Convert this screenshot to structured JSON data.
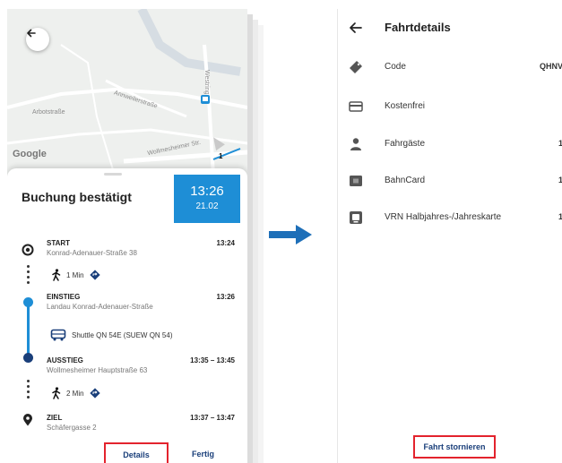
{
  "left_screen": {
    "map": {
      "labels": [
        "Arbotstraße",
        "Annweilerstraße",
        "Westring",
        "Wollmesheimer Str."
      ],
      "logo": "Google",
      "badge": "1"
    },
    "sheet": {
      "title": "Buchung bestätigt",
      "time_card": {
        "time": "13:26",
        "date": "21.02",
        "color": "#1e8ed6"
      },
      "stops": [
        {
          "name": "START",
          "address": "Konrad-Adenauer-Straße 38",
          "time": "13:24",
          "icon": "origin-target-icon"
        },
        {
          "name": "EINSTIEG",
          "address": "Landau Konrad-Adenauer-Straße",
          "time": "13:26",
          "icon": "boarding-dot-icon"
        },
        {
          "name": "AUSSTIEG",
          "address": "Wollmesheimer Hauptstraße 63",
          "time": "13:35 – 13:45",
          "icon": "alighting-dot-icon"
        },
        {
          "name": "ZIEL",
          "address": "Schäfergasse 2",
          "time": "13:37 – 13:47",
          "icon": "destination-pin-icon"
        }
      ],
      "segments": [
        {
          "text": "1 Min",
          "icon": "walk-icon"
        },
        {
          "text": "Shuttle QN 54E (SUEW QN 54)",
          "icon": "bus-icon"
        },
        {
          "text": "2 Min",
          "icon": "walk-icon"
        }
      ],
      "buttons": {
        "details": "Details",
        "done": "Fertig"
      }
    }
  },
  "right_screen": {
    "title": "Fahrtdetails",
    "rows": [
      {
        "label": "Code",
        "value": "QHNV",
        "icon": "ticket-icon"
      },
      {
        "label": "Kostenfrei",
        "value": "",
        "icon": "credit-card-icon"
      },
      {
        "label": "Fahrgäste",
        "value": "1",
        "icon": "person-icon"
      },
      {
        "label": "BahnCard",
        "value": "1",
        "icon": "bahncard-icon"
      },
      {
        "label": "VRN Halbjahres-/Jahreskarte",
        "value": "1",
        "icon": "pass-card-icon"
      }
    ],
    "cancel_button": "Fahrt stornieren"
  },
  "colors": {
    "accent": "#1e8ed6",
    "highlight": "#e3232d",
    "button_text": "#1a3f7a"
  }
}
